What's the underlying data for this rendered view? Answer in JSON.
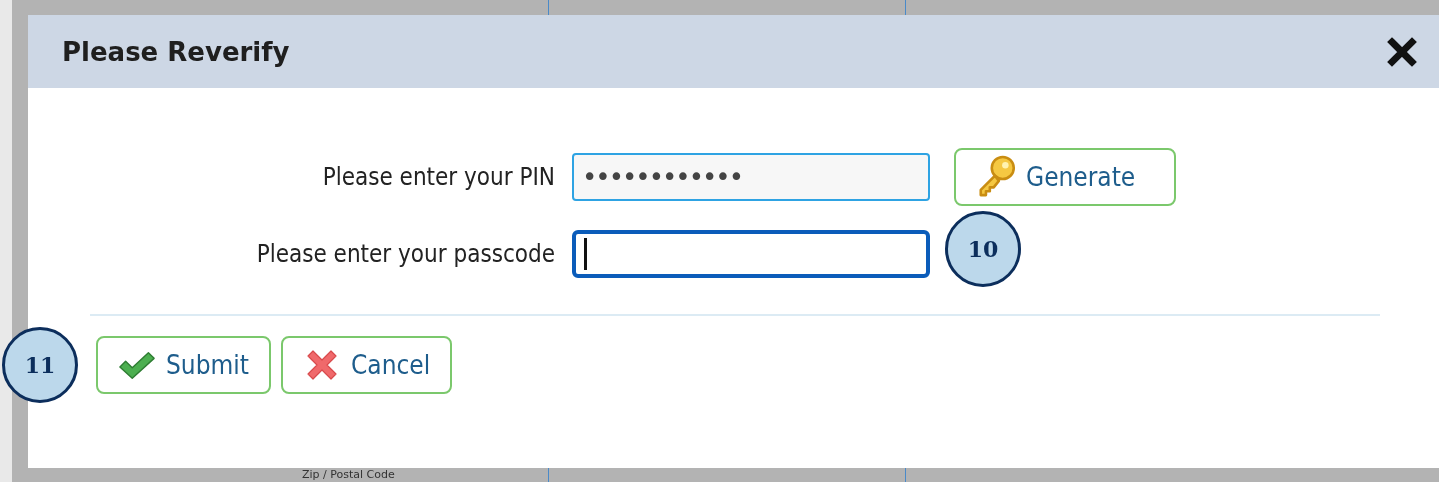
{
  "background": {
    "label": "Zip / Postal Code"
  },
  "dialog": {
    "title": "Please Reverify",
    "fields": [
      {
        "label": "Please enter your PIN",
        "value": "••••••••••••",
        "focused": false
      },
      {
        "label": "Please enter your passcode",
        "focused": true
      }
    ],
    "generate_button": {
      "label": "Generate",
      "kind": "key"
    },
    "buttons": [
      {
        "label": "Submit",
        "kind": "check"
      },
      {
        "label": "Cancel",
        "kind": "cross"
      }
    ]
  },
  "callouts": [
    {
      "label": "10"
    },
    {
      "label": "11"
    }
  ]
}
